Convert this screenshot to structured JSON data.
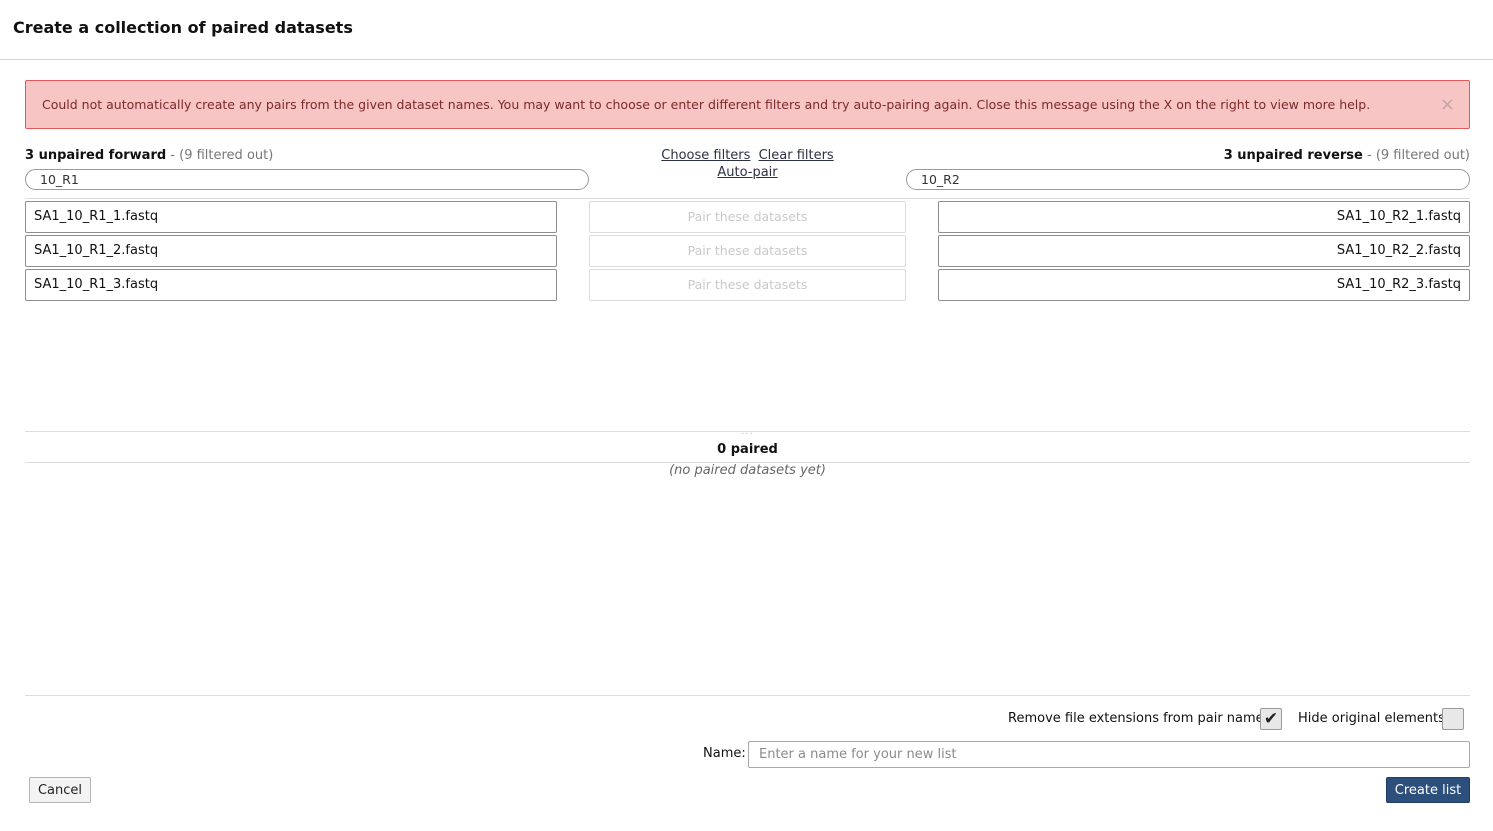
{
  "header": {
    "title": "Create a collection of paired datasets"
  },
  "alert": {
    "message": "Could not automatically create any pairs from the given dataset names. You may want to choose or enter different filters and try auto-pairing again. Close this message using the X on the right to view more help.",
    "close_glyph": "×"
  },
  "forward": {
    "count_label": "3 unpaired forward",
    "filtered_label": " - (9 filtered out)",
    "filter_value": "10_R1",
    "items": [
      "SA1_10_R1_1.fastq",
      "SA1_10_R1_2.fastq",
      "SA1_10_R1_3.fastq"
    ]
  },
  "reverse": {
    "count_label": "3 unpaired reverse",
    "filtered_label": " - (9 filtered out)",
    "filter_value": "10_R2",
    "items": [
      "SA1_10_R2_1.fastq",
      "SA1_10_R2_2.fastq",
      "SA1_10_R2_3.fastq"
    ]
  },
  "middle": {
    "choose_filters": "Choose filters",
    "clear_filters": "Clear filters",
    "auto_pair": "Auto-pair",
    "pair_button_label": "Pair these datasets"
  },
  "paired": {
    "drag_handle": "...",
    "title": "0 paired",
    "empty_message": "(no paired datasets yet)"
  },
  "footer": {
    "remove_extensions_label": "Remove file extensions from pair names?",
    "remove_extensions_checked": true,
    "hide_original_label": "Hide original elements?",
    "hide_original_checked": false,
    "check_glyph": "✔",
    "name_label": "Name:",
    "name_placeholder": "Enter a name for your new list",
    "name_value": "",
    "cancel_label": "Cancel",
    "create_label": "Create list"
  },
  "colors": {
    "alert_bg": "#f8c5c5",
    "alert_border": "#e05a5a",
    "primary_button": "#2c4f7c"
  }
}
